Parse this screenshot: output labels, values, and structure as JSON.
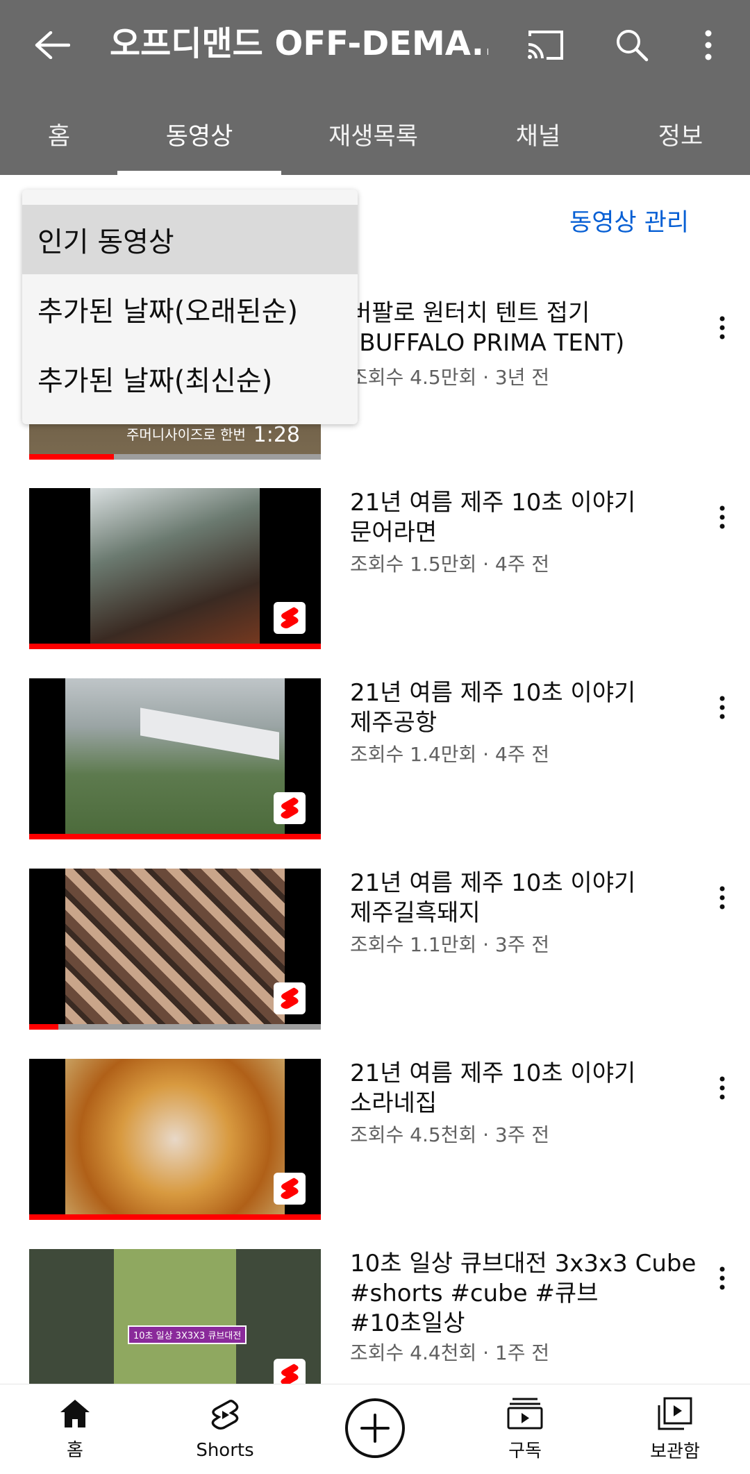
{
  "header": {
    "title": "오프디맨드 OFF-DEMA...",
    "icons": [
      "back-arrow-icon",
      "cast-icon",
      "search-icon",
      "more-vert-icon"
    ]
  },
  "tabs": [
    {
      "label": "홈",
      "active": false
    },
    {
      "label": "동영상",
      "active": true
    },
    {
      "label": "재생목록",
      "active": false
    },
    {
      "label": "채널",
      "active": false
    },
    {
      "label": "정보",
      "active": false
    }
  ],
  "manage_label": "동영상 관리",
  "sort_menu": {
    "items": [
      {
        "label": "인기 동영상",
        "selected": true
      },
      {
        "label": "추가된 날짜(오래된순)",
        "selected": false
      },
      {
        "label": "추가된 날짜(최신순)",
        "selected": false
      }
    ]
  },
  "videos": [
    {
      "title_line1": "버팔로 원터치 텐트 접기",
      "title_line2": "(BUFFALO PRIMA TENT)",
      "meta": "조회수 4.5만회 · 3년 전",
      "duration": "1:28",
      "thumb_caption": "주머니사이즈로 한번",
      "progress": 0.29,
      "is_short": false
    },
    {
      "title_line1": "21년 여름 제주 10초 이야기",
      "title_line2": "문어라면",
      "meta": "조회수 1.5만회 · 4주 전",
      "progress": 1.0,
      "is_short": true
    },
    {
      "title_line1": "21년 여름 제주 10초 이야기",
      "title_line2": "제주공항",
      "meta": "조회수 1.4만회 · 4주 전",
      "progress": 1.0,
      "is_short": true
    },
    {
      "title_line1": "21년 여름 제주 10초 이야기",
      "title_line2": "제주길흑돼지",
      "meta": "조회수 1.1만회 · 3주 전",
      "progress": 0.1,
      "is_short": true
    },
    {
      "title_line1": "21년 여름 제주 10초 이야기",
      "title_line2": "소라네집",
      "meta": "조회수 4.5천회 · 3주 전",
      "progress": 1.0,
      "is_short": true
    },
    {
      "title_line1": "10초 일상 큐브대전 3x3x3 Cube",
      "title_line2": "#shorts #cube #큐브",
      "title_line3": "#10초일상",
      "meta": "조회수 4.4천회 · 1주 전",
      "thumb_caption": "10초 일상 3X3X3 큐브대전",
      "is_short": true
    }
  ],
  "bottom_nav": [
    {
      "label": "홈",
      "icon": "home-icon"
    },
    {
      "label": "Shorts",
      "icon": "shorts-icon"
    },
    {
      "label": "",
      "icon": "create-plus-icon"
    },
    {
      "label": "구독",
      "icon": "subscriptions-icon"
    },
    {
      "label": "보관함",
      "icon": "library-icon"
    }
  ],
  "colors": {
    "header_bg": "#6a6a6a",
    "link": "#065fd4",
    "progress": "#ff0000"
  }
}
